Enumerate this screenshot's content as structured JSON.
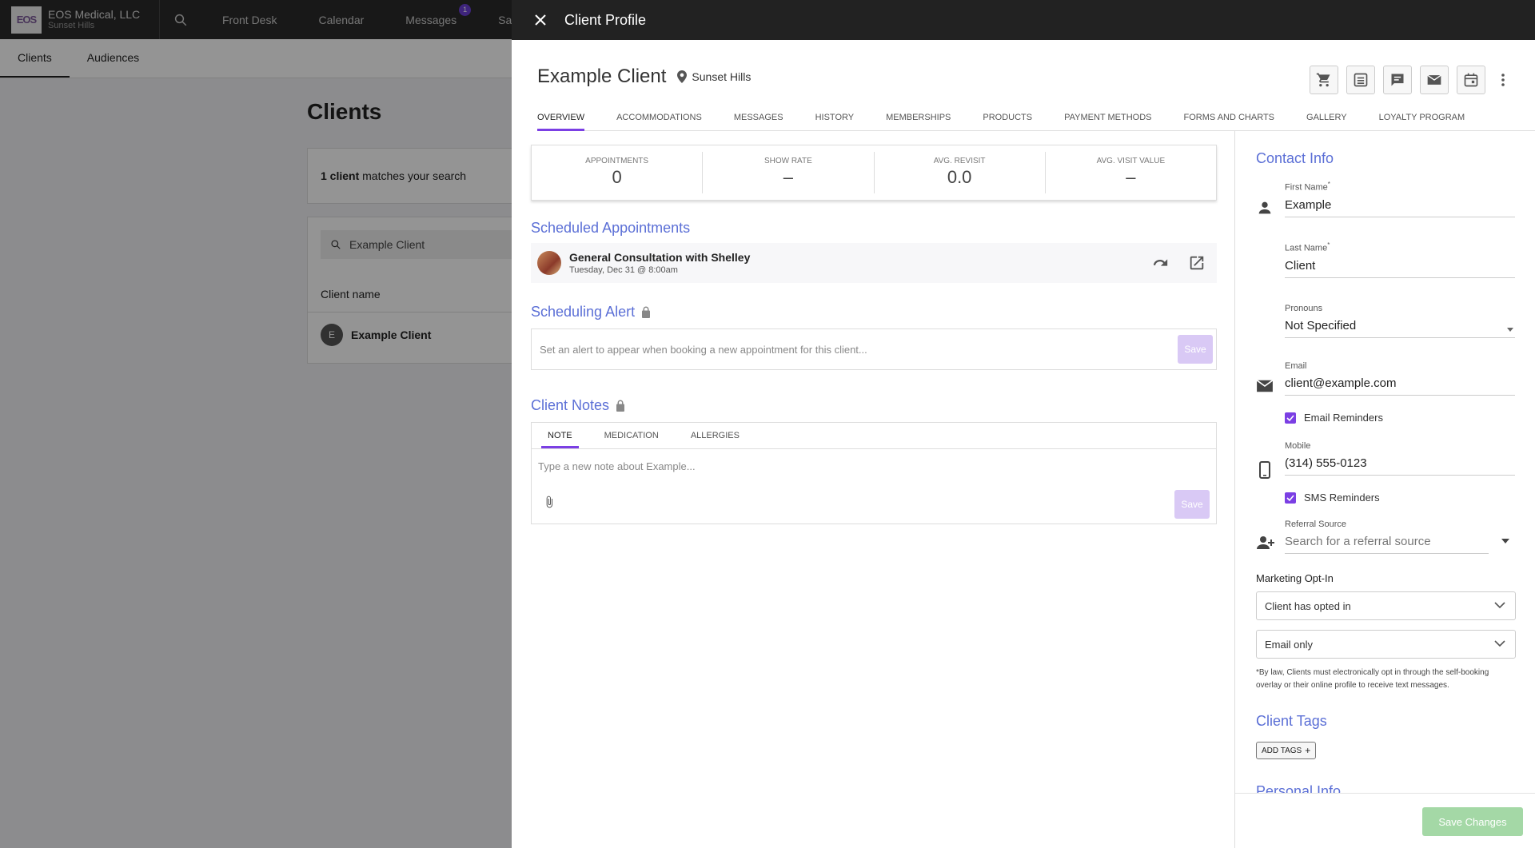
{
  "app": {
    "brand_name": "EOS Medical, LLC",
    "brand_location": "Sunset Hills",
    "logo_text": "EOS",
    "nav": [
      "Front Desk",
      "Calendar",
      "Messages",
      "Sales"
    ],
    "messages_badge": "1",
    "subtabs": [
      "Clients",
      "Audiences"
    ],
    "page_title": "Clients",
    "match_count": "1 client",
    "match_suffix": " matches your search",
    "search_value": "Example Client",
    "column_header": "Client name",
    "client_initial": "E",
    "client_row": "Example Client"
  },
  "drawer": {
    "title": "Client Profile",
    "client_name": "Example Client",
    "location": "Sunset Hills",
    "tabs": [
      "OVERVIEW",
      "ACCOMMODATIONS",
      "MESSAGES",
      "HISTORY",
      "MEMBERSHIPS",
      "PRODUCTS",
      "PAYMENT METHODS",
      "FORMS AND CHARTS",
      "GALLERY",
      "LOYALTY PROGRAM"
    ],
    "stats": [
      {
        "label": "APPOINTMENTS",
        "value": "0"
      },
      {
        "label": "SHOW RATE",
        "value": "–"
      },
      {
        "label": "AVG. REVISIT",
        "value": "0.0"
      },
      {
        "label": "AVG. VISIT VALUE",
        "value": "–"
      }
    ],
    "scheduled_title": "Scheduled Appointments",
    "appointment": {
      "title": "General Consultation with Shelley",
      "date": "Tuesday, Dec 31 @ 8:00am"
    },
    "alert_title": "Scheduling Alert",
    "alert_placeholder": "Set an alert to appear when booking a new appointment for this client...",
    "save_label": "Save",
    "notes_title": "Client Notes",
    "note_tabs": [
      "NOTE",
      "MEDICATION",
      "ALLERGIES"
    ],
    "note_placeholder": "Type a new note about Example..."
  },
  "contact": {
    "title": "Contact Info",
    "first_name_label": "First Name",
    "first_name": "Example",
    "last_name_label": "Last Name",
    "last_name": "Client",
    "required_mark": "*",
    "pronouns_label": "Pronouns",
    "pronouns": "Not Specified",
    "email_label": "Email",
    "email": "client@example.com",
    "email_reminders": "Email Reminders",
    "mobile_label": "Mobile",
    "mobile": "(314) 555-0123",
    "sms_reminders": "SMS Reminders",
    "referral_label": "Referral Source",
    "referral_placeholder": "Search for a referral source",
    "marketing_label": "Marketing Opt-In",
    "optin_value": "Client has opted in",
    "channel_value": "Email only",
    "law_text": "*By law, Clients must electronically opt in through the self-booking overlay or their online profile to receive text messages.",
    "tags_title": "Client Tags",
    "add_tags": "ADD TAGS",
    "personal_title": "Personal Info",
    "save_changes": "Save Changes"
  },
  "colors": {
    "accent": "#7b3fe4",
    "section": "#5b6fd6",
    "save_green": "#a4d8a6"
  }
}
